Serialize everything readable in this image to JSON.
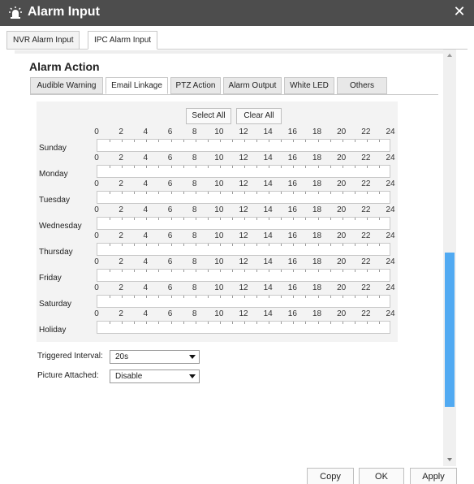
{
  "window": {
    "title": "Alarm Input",
    "close_symbol": "✕"
  },
  "outer_tabs": [
    {
      "label": "NVR Alarm Input",
      "active": false
    },
    {
      "label": "IPC Alarm Input",
      "active": true
    }
  ],
  "section": {
    "title": "Alarm Action"
  },
  "inner_tabs": [
    {
      "label": "Audible Warning",
      "active": false
    },
    {
      "label": "Email Linkage",
      "active": true
    },
    {
      "label": "PTZ Action",
      "active": false
    },
    {
      "label": "Alarm Output",
      "active": false
    },
    {
      "label": "White LED",
      "active": false
    },
    {
      "label": "Others",
      "active": false
    }
  ],
  "schedule": {
    "select_all_label": "Select All",
    "clear_all_label": "Clear All",
    "hour_ticks": [
      "0",
      "2",
      "4",
      "6",
      "8",
      "10",
      "12",
      "14",
      "16",
      "18",
      "20",
      "22",
      "24"
    ],
    "days": [
      "Sunday",
      "Monday",
      "Tuesday",
      "Wednesday",
      "Thursday",
      "Friday",
      "Saturday",
      "Holiday"
    ]
  },
  "form": {
    "triggered_interval_label": "Triggered Interval:",
    "triggered_interval_value": "20s",
    "picture_attached_label": "Picture Attached:",
    "picture_attached_value": "Disable"
  },
  "footer": {
    "copy_label": "Copy",
    "ok_label": "OK",
    "apply_label": "Apply"
  },
  "colors": {
    "titlebar": "#4d4d4d",
    "scroll_thumb": "#51aaf2",
    "panel_bg": "#f3f3f3"
  }
}
